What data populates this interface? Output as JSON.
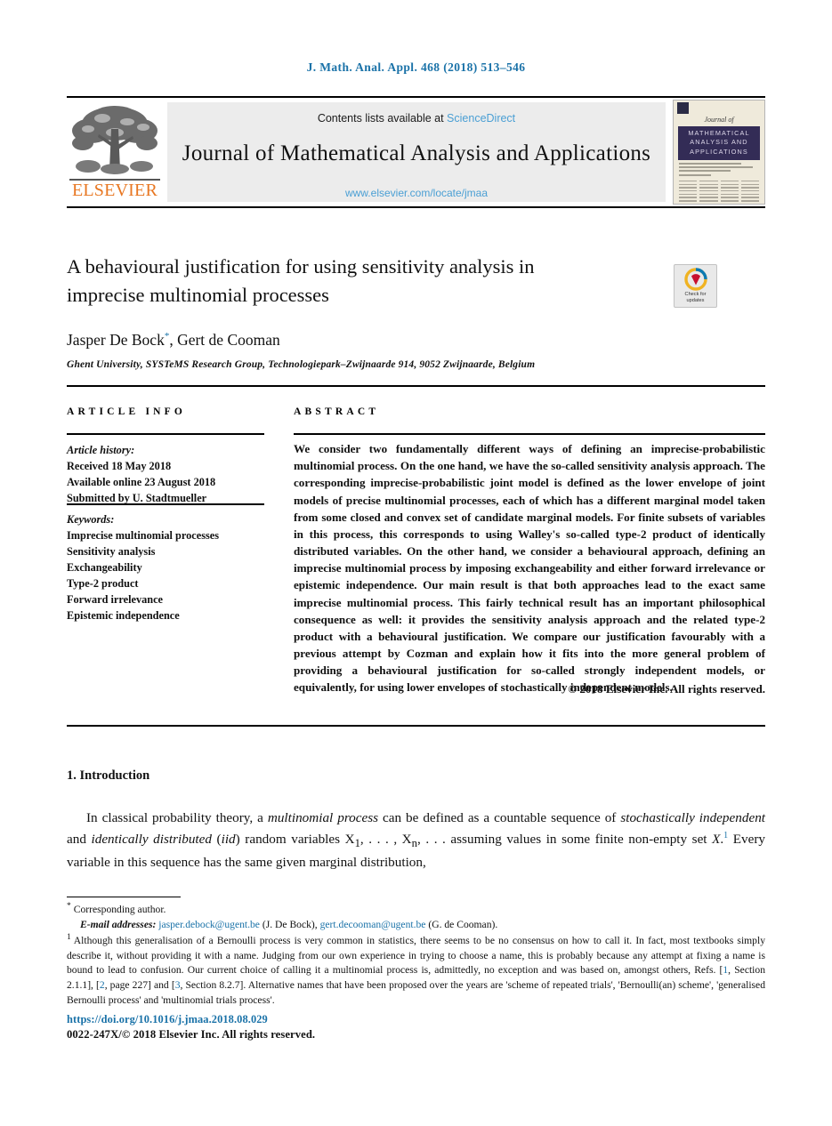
{
  "running_head": "J. Math. Anal. Appl. 468 (2018) 513–546",
  "masthead": {
    "contents_prefix": "Contents lists available at ",
    "sciencedirect": "ScienceDirect",
    "journal_name": "Journal of Mathematical Analysis and Applications",
    "journal_url": "www.elsevier.com/locate/jmaa",
    "publisher": "ELSEVIER",
    "publisher_logo_name": "elsevier-tree-logo",
    "cover": {
      "jof": "Journal of",
      "band_line1": "MATHEMATICAL",
      "band_line2": "ANALYSIS AND",
      "band_line3": "APPLICATIONS"
    }
  },
  "article": {
    "title": "A behavioural justification for using sensitivity analysis in imprecise multinomial processes",
    "authors": "Jasper De Bock",
    "author_marker": "*",
    "authors_rest": ", Gert de Cooman",
    "affiliation": "Ghent University, SYSTeMS Research Group, Technologiepark–Zwijnaarde 914, 9052 Zwijnaarde, Belgium",
    "crossmark": {
      "line1": "Check for",
      "line2": "updates",
      "ring_colors": [
        "#f0b323",
        "#c8102e",
        "#0b7ab3"
      ]
    }
  },
  "info": {
    "heading": "ARTICLE INFO",
    "history_label": "Article history:",
    "history": [
      "Received 18 May 2018",
      "Available online 23 August 2018",
      "Submitted by U. Stadtmueller"
    ],
    "keywords_label": "Keywords:",
    "keywords": [
      "Imprecise multinomial processes",
      "Sensitivity analysis",
      "Exchangeability",
      "Type-2 product",
      "Forward irrelevance",
      "Epistemic independence"
    ]
  },
  "abstract": {
    "heading": "ABSTRACT",
    "text": "We consider two fundamentally different ways of defining an imprecise-probabilistic multinomial process. On the one hand, we have the so-called sensitivity analysis approach. The corresponding imprecise-probabilistic joint model is defined as the lower envelope of joint models of precise multinomial processes, each of which has a different marginal model taken from some closed and convex set of candidate marginal models. For finite subsets of variables in this process, this corresponds to using Walley's so-called type-2 product of identically distributed variables. On the other hand, we consider a behavioural approach, defining an imprecise multinomial process by imposing exchangeability and either forward irrelevance or epistemic independence. Our main result is that both approaches lead to the exact same imprecise multinomial process. This fairly technical result has an important philosophical consequence as well: it provides the sensitivity analysis approach and the related type-2 product with a behavioural justification. We compare our justification favourably with a previous attempt by Cozman and explain how it fits into the more general problem of providing a behavioural justification for so-called strongly independent models, or equivalently, for using lower envelopes of stochastically independent models.",
    "copyright": "© 2018 Elsevier Inc. All rights reserved."
  },
  "body": {
    "section_number": "1.",
    "section_title": "Introduction",
    "paragraph_part1": "In classical probability theory, a ",
    "paragraph_em1": "multinomial process",
    "paragraph_part2": " can be defined as a countable sequence of ",
    "paragraph_em2": "stochastically independent",
    "paragraph_part3": " and ",
    "paragraph_em3": "identically distributed",
    "paragraph_part4": " (",
    "paragraph_em4": "iid",
    "paragraph_part5": ") random variables X",
    "paragraph_sub1": "1",
    "paragraph_part6": ", . . . , X",
    "paragraph_sub2": "n",
    "paragraph_part7": ", . . . assuming values in some finite non-empty set ",
    "paragraph_setx": "X",
    "paragraph_part8": ".",
    "footnote_ref": "1",
    "paragraph_part9": " Every variable in this sequence has the same given marginal distribution,"
  },
  "footnotes": {
    "corresponding_mark": "*",
    "corresponding": "Corresponding author.",
    "email_label": "E-mail addresses:",
    "email1": "jasper.debock@ugent.be",
    "email1_owner": "(J. De Bock),",
    "email2": "gert.decooman@ugent.be",
    "email2_owner": "(G. de Cooman).",
    "note1_mark": "1",
    "note1_a": "Although this generalisation of a Bernoulli process is very common in statistics, there seems to be no consensus on how to call it. In fact, most textbooks simply describe it, without providing it with a name. Judging from our own experience in trying to choose a name, this is probably because any attempt at fixing a name is bound to lead to confusion. Our current choice of calling it a multinomial process is, admittedly, no exception and was based on, amongst others, Refs. [",
    "note1_cit1": "1",
    "note1_b": ", Section 2.1.1], [",
    "note1_cit2": "2",
    "note1_c": ", page 227] and [",
    "note1_cit3": "3",
    "note1_d": ", Section 8.2.7]. Alternative names that have been proposed over the years are 'scheme of repeated trials', 'Bernoulli(an) scheme', 'generalised Bernoulli process' and 'multinomial trials process'."
  },
  "footer": {
    "doi": "https://doi.org/10.1016/j.jmaa.2018.08.029",
    "issn_line": "0022-247X/© 2018 Elsevier Inc. All rights reserved."
  },
  "colors": {
    "link_blue": "#1a72a8",
    "sciencedirect_blue": "#4a9fd4",
    "elsevier_orange": "#e87722",
    "cover_band": "#332c56"
  }
}
